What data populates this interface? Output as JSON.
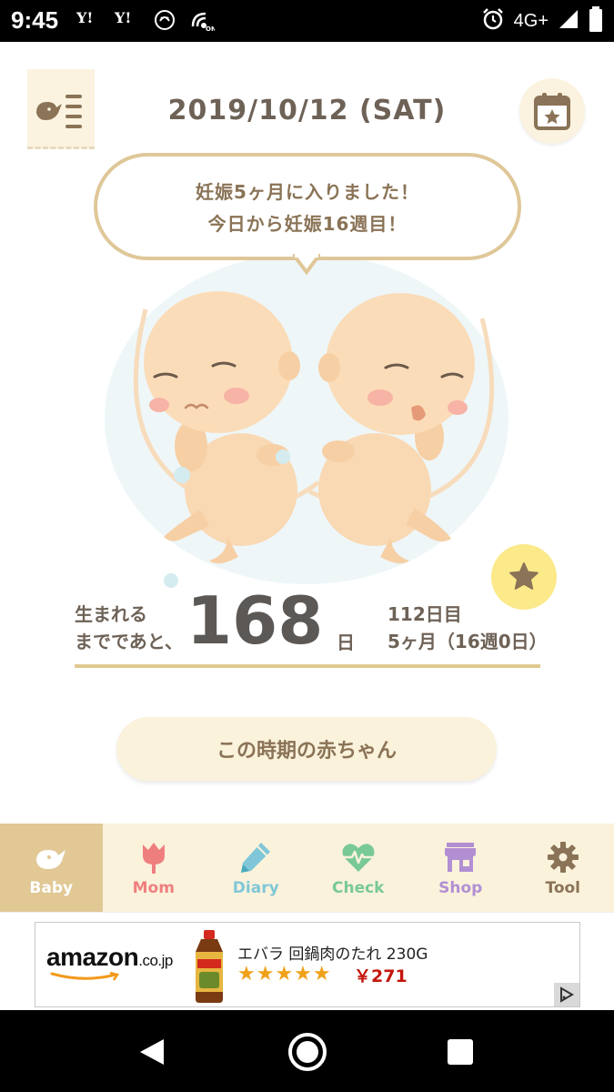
{
  "status_bar": {
    "time": "9:45",
    "icons": [
      "Y!",
      "Y!",
      "notification-icon",
      "nfc-icon"
    ],
    "network": "4G+",
    "alarm_icon": "alarm-icon",
    "signal_icon": "signal-icon",
    "battery_icon": "battery-icon"
  },
  "header": {
    "menu_icon": "bird-list-icon",
    "date": "2019/10/12 (SAT)",
    "calendar_icon": "calendar-star-icon"
  },
  "bubble": {
    "line1": "妊娠5ヶ月に入りました！",
    "line2": "今日から妊娠16週目！"
  },
  "illustration": {
    "subject": "twin-fetus-illustration"
  },
  "countdown": {
    "label_line1": "生まれる",
    "label_line2": "までであと、",
    "days_left": "168",
    "unit": "日",
    "day_count": "112日目",
    "gestation": "5ヶ月（16週0日）"
  },
  "baby_button": {
    "label": "この時期の赤ちゃん"
  },
  "tabs": [
    {
      "label": "Baby",
      "icon": "bird-icon",
      "color": "#ffffff",
      "active": true
    },
    {
      "label": "Mom",
      "icon": "tulip-icon",
      "color": "#ef7f7f",
      "active": false
    },
    {
      "label": "Diary",
      "icon": "pencil-icon",
      "color": "#7fc7d8",
      "active": false
    },
    {
      "label": "Check",
      "icon": "heartbeat-icon",
      "color": "#78c996",
      "active": false
    },
    {
      "label": "Shop",
      "icon": "store-icon",
      "color": "#b28fd3",
      "active": false
    },
    {
      "label": "Tool",
      "icon": "gear-icon",
      "color": "#8a7356",
      "active": false
    }
  ],
  "ad": {
    "brand": "amazon",
    "brand_suffix": ".co.jp",
    "product_name": "エバラ 回鍋肉のたれ 230G",
    "rating_stars": "★★★★★",
    "price": "￥271",
    "adchoices_icon": "adchoices-icon"
  },
  "navbar": {
    "back_icon": "back-icon",
    "home_icon": "home-icon",
    "recents_icon": "recents-icon"
  }
}
